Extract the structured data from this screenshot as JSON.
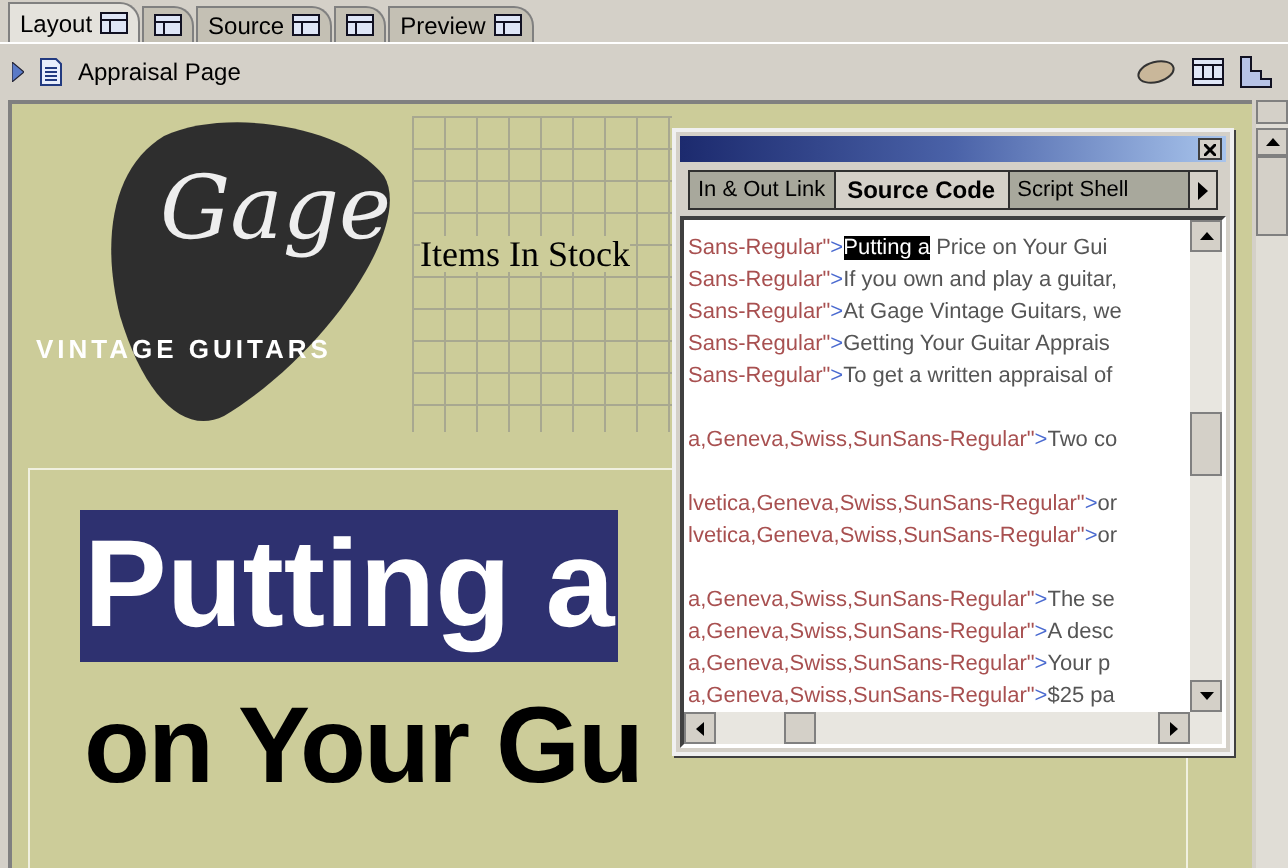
{
  "tabs": [
    {
      "kind": "text",
      "label": "Layout",
      "selected": true
    },
    {
      "kind": "icon",
      "selected": false
    },
    {
      "kind": "text",
      "label": "Source",
      "selected": false
    },
    {
      "kind": "icon",
      "selected": false
    },
    {
      "kind": "text",
      "label": "Preview",
      "selected": false
    }
  ],
  "toolbar": {
    "page_title": "Appraisal Page"
  },
  "document": {
    "logo": {
      "script": "Gage",
      "tagline": "VINTAGE GUITARS"
    },
    "nav_heading": "Items In Stock",
    "headline": [
      {
        "text": "Putting a",
        "highlighted": true
      },
      {
        "text": "on Your Gu",
        "highlighted": false
      }
    ]
  },
  "palette": {
    "tabs": [
      {
        "label": "In & Out Link",
        "selected": false
      },
      {
        "label": "Source Code",
        "selected": true
      },
      {
        "label": "Script Shell",
        "selected": false
      }
    ],
    "lines": [
      {
        "kind": "code",
        "attr": "Sans-Regular\"",
        "bracket": ">",
        "highlight": "Putting a",
        "text": " Price on Your Gui"
      },
      {
        "kind": "code",
        "attr": "Sans-Regular\"",
        "bracket": ">",
        "text": "If you own and play a guitar,"
      },
      {
        "kind": "code",
        "attr": "Sans-Regular\"",
        "bracket": ">",
        "text": "At Gage Vintage Guitars, we"
      },
      {
        "kind": "code",
        "attr": "Sans-Regular\"",
        "bracket": ">",
        "text": "Getting Your Guitar Apprais"
      },
      {
        "kind": "code",
        "attr": "Sans-Regular\"",
        "bracket": ">",
        "text": "To get a written appraisal of"
      },
      {
        "kind": "blank"
      },
      {
        "kind": "code",
        "attr": "a,Geneva,Swiss,SunSans-Regular\"",
        "bracket": ">",
        "text": "Two co"
      },
      {
        "kind": "blank"
      },
      {
        "kind": "code",
        "attr": "lvetica,Geneva,Swiss,SunSans-Regular\"",
        "bracket": ">",
        "text": "or"
      },
      {
        "kind": "code",
        "attr": "lvetica,Geneva,Swiss,SunSans-Regular\"",
        "bracket": ">",
        "text": "or"
      },
      {
        "kind": "blank"
      },
      {
        "kind": "code",
        "attr": "a,Geneva,Swiss,SunSans-Regular\"",
        "bracket": ">",
        "text": "The se"
      },
      {
        "kind": "code",
        "attr": "a,Geneva,Swiss,SunSans-Regular\"",
        "bracket": ">",
        "text": "A desc"
      },
      {
        "kind": "code",
        "attr": "a,Geneva,Swiss,SunSans-Regular\"",
        "bracket": ">",
        "text": "Your p"
      },
      {
        "kind": "code",
        "attr": "a,Geneva,Swiss,SunSans-Regular\"",
        "bracket": ">",
        "text": "$25 pa"
      }
    ]
  }
}
